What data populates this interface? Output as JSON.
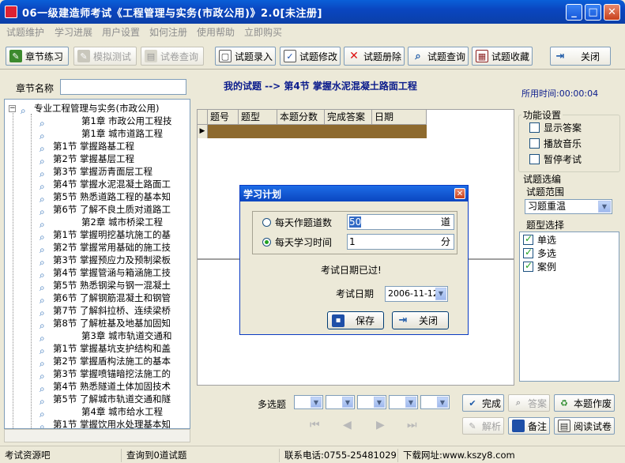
{
  "window": {
    "title": "06一级建造师考试《工程管理与实务(市政公用)》2.0[未注册]",
    "minimize": "_",
    "maximize": "□",
    "close": "✕"
  },
  "menu": [
    "试题维护",
    "学习进展",
    "用户设置",
    "如何注册",
    "使用帮助",
    "立即购买"
  ],
  "toolbar": {
    "left": [
      {
        "label": "章节练习",
        "icon": "practice-icon",
        "enabled": true
      },
      {
        "label": "模拟测试",
        "icon": "mock-icon",
        "enabled": false
      },
      {
        "label": "试卷查询",
        "icon": "paper-icon",
        "enabled": false
      }
    ],
    "right": [
      {
        "label": "试题录入",
        "icon": "entry-icon"
      },
      {
        "label": "试题修改",
        "icon": "edit-icon"
      },
      {
        "label": "试题册除",
        "icon": "delete-icon"
      },
      {
        "label": "试题查询",
        "icon": "search-icon"
      },
      {
        "label": "试题收藏",
        "icon": "favorite-icon"
      },
      {
        "label": "关闭",
        "icon": "exit-icon"
      }
    ]
  },
  "sidebar": {
    "chapter_label": "章节名称",
    "chapter_value": "",
    "tree": [
      {
        "text": "专业工程管理与实务(市政公用)",
        "level": 0
      },
      {
        "text": "第1章   市政公用工程技",
        "level": 2
      },
      {
        "text": "第1章   城市道路工程",
        "level": 2
      },
      {
        "text": "第1节  掌握路基工程",
        "level": 1
      },
      {
        "text": "第2节  掌握基层工程",
        "level": 1
      },
      {
        "text": "第3节  掌握沥青面层工程",
        "level": 1
      },
      {
        "text": "第4节  掌握水泥混凝土路面工",
        "level": 1
      },
      {
        "text": "第5节  熟悉道路工程的基本知",
        "level": 1
      },
      {
        "text": "第6节  了解不良土质对道路工",
        "level": 1
      },
      {
        "text": "第2章   城市桥梁工程",
        "level": 2
      },
      {
        "text": "第1节  掌握明挖基坑施工的基",
        "level": 1
      },
      {
        "text": "第2节  掌握常用基础的施工技",
        "level": 1
      },
      {
        "text": "第3节  掌握预应力及预制梁板",
        "level": 1
      },
      {
        "text": "第4节  掌握管涵与箱涵施工技",
        "level": 1
      },
      {
        "text": "第5节  熟悉钢梁与钢一混凝土",
        "level": 1
      },
      {
        "text": "第6节  了解钢筋混凝土和钢管",
        "level": 1
      },
      {
        "text": "第7节  了解斜拉桥、连续梁桥",
        "level": 1
      },
      {
        "text": "第8节  了解桩基及地基加固知",
        "level": 1
      },
      {
        "text": "第3章   城市轨道交通和",
        "level": 2
      },
      {
        "text": "第1节  掌握基坑支护结构和盖",
        "level": 1
      },
      {
        "text": "第2节  掌握盾构法施工的基本",
        "level": 1
      },
      {
        "text": "第3节  掌握喷锚暗挖法施工的",
        "level": 1
      },
      {
        "text": "第4节  熟悉隧道土体加固技术",
        "level": 1
      },
      {
        "text": "第5节  了解城市轨道交通和隧",
        "level": 1
      },
      {
        "text": "第4章   城市给水工程",
        "level": 2
      },
      {
        "text": "第1节  掌握饮用水处理基本知",
        "level": 1
      }
    ]
  },
  "header": {
    "path": "我的试题  --> 第4节  掌握水泥混凝土路面工程",
    "timer": "所用时间:00:00:04"
  },
  "grid": {
    "columns": [
      "题号",
      "题型",
      "本题分数",
      "完成答案",
      "日期"
    ],
    "row_indicator": "▶"
  },
  "function_settings": {
    "title": "功能设置",
    "items": [
      {
        "label": "显示答案",
        "checked": false
      },
      {
        "label": "播放音乐",
        "checked": false
      },
      {
        "label": "暂停考试",
        "checked": false
      }
    ]
  },
  "question_select": {
    "title": "试题选编",
    "scope_label": "试题范围",
    "scope_value": "习题重温",
    "type_label": "题型选择",
    "types": [
      {
        "label": "单选",
        "checked": true
      },
      {
        "label": "多选",
        "checked": true
      },
      {
        "label": "案例",
        "checked": true
      }
    ]
  },
  "answer_bar": {
    "multi_label": "多选题",
    "buttons": {
      "complete": "完成",
      "answer": "答案",
      "difficulty": "本题作废",
      "analysis": "解析",
      "note": "备注",
      "read": "阅读试卷"
    },
    "nav": [
      "⏮",
      "◀",
      "▶",
      "⏭"
    ]
  },
  "statusbar": {
    "site": "考试资源吧",
    "query": "查询到0道试题",
    "phone": "联系电话:0755-25481029",
    "url": "下载网址:www.kszy8.com"
  },
  "dialog": {
    "title": "学习计划",
    "close": "✕",
    "options": [
      {
        "label": "每天作题道数",
        "value": "50",
        "unit": "道",
        "selected": false
      },
      {
        "label": "每天学习时间",
        "value": "1",
        "unit": "分",
        "selected": true
      }
    ],
    "message": "考试日期已过!",
    "date_label": "考试日期",
    "date_value": "2006-11-12",
    "save": "保存",
    "close_btn": "关闭"
  },
  "colors": {
    "titlebar": "#0A46C0",
    "selected_row": "#8E6A2E",
    "header_text": "#0B1C8C",
    "face": "#ECE9D8"
  }
}
